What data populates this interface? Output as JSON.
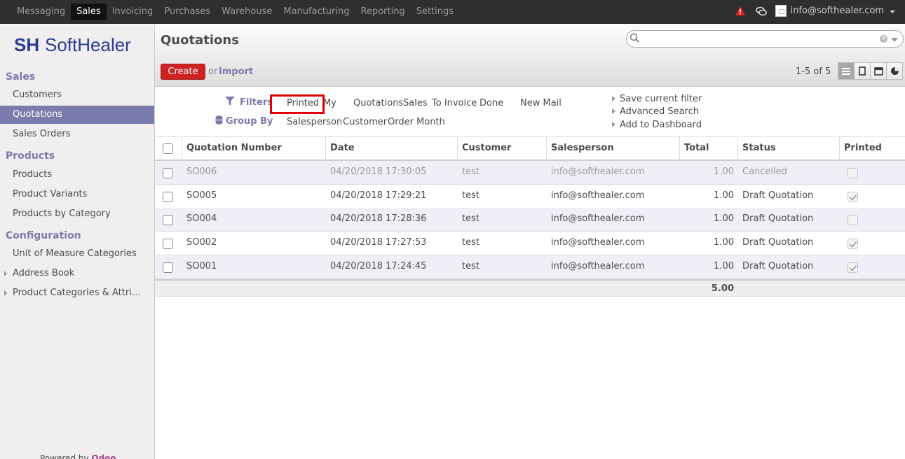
{
  "topbar": {
    "menu": [
      "Messaging",
      "Sales",
      "Invoicing",
      "Purchases",
      "Warehouse",
      "Manufacturing",
      "Reporting",
      "Settings"
    ],
    "active_menu": "Sales",
    "user_email": "info@softhealer.com",
    "icons": [
      "warning-icon",
      "chat-icon",
      "avatar",
      "chevron-down-icon"
    ]
  },
  "sidebar": {
    "logo_text": "SoftHealer",
    "sections": [
      {
        "title": "Sales",
        "items": [
          "Customers",
          "Quotations",
          "Sales Orders"
        ]
      },
      {
        "title": "Products",
        "items": [
          "Products",
          "Product Variants",
          "Products by Category"
        ]
      },
      {
        "title": "Configuration",
        "items": [
          "Unit of Measure Categories",
          "Address Book",
          "Product Categories & Attri…"
        ]
      }
    ],
    "active_item": "Quotations",
    "powered_prefix": "Powered by",
    "powered_brand": "Odoo"
  },
  "control_panel": {
    "title": "Quotations",
    "search_placeholder": "",
    "create_label": "Create",
    "or_label": "or",
    "import_label": "Import",
    "pager": "1-5 of 5",
    "views": [
      "list-view-icon",
      "kanban-view-icon",
      "calendar-view-icon",
      "graph-view-icon"
    ],
    "active_view": "list-view-icon"
  },
  "filters": {
    "filters_label": "Filters",
    "group_by_label": "Group By",
    "filter_items": [
      "Printed",
      "My",
      "Quotations",
      "Sales",
      "To Invoice",
      "Done",
      "New Mail"
    ],
    "highlighted_filter": "Printed",
    "group_items": [
      "Salesperson",
      "Customer",
      "Order Month"
    ],
    "options": [
      "Save current filter",
      "Advanced Search",
      "Add to Dashboard"
    ]
  },
  "table": {
    "columns": [
      "Quotation Number",
      "Date",
      "Customer",
      "Salesperson",
      "Total",
      "Status",
      "Printed"
    ],
    "rows": [
      {
        "number": "SO006",
        "date": "04/20/2018 17:30:05",
        "customer": "test",
        "salesperson": "info@softhealer.com",
        "total": "1.00",
        "status": "Cancelled",
        "printed": false
      },
      {
        "number": "SO005",
        "date": "04/20/2018 17:29:21",
        "customer": "test",
        "salesperson": "info@softhealer.com",
        "total": "1.00",
        "status": "Draft Quotation",
        "printed": true
      },
      {
        "number": "SO004",
        "date": "04/20/2018 17:28:36",
        "customer": "test",
        "salesperson": "info@softhealer.com",
        "total": "1.00",
        "status": "Draft Quotation",
        "printed": false
      },
      {
        "number": "SO002",
        "date": "04/20/2018 17:27:53",
        "customer": "test",
        "salesperson": "info@softhealer.com",
        "total": "1.00",
        "status": "Draft Quotation",
        "printed": true
      },
      {
        "number": "SO001",
        "date": "04/20/2018 17:24:45",
        "customer": "test",
        "salesperson": "info@softhealer.com",
        "total": "1.00",
        "status": "Draft Quotation",
        "printed": true
      }
    ],
    "sum_total": "5.00"
  },
  "colors": {
    "accent": "#7c7bad",
    "create": "#cc2222",
    "highlight": "#e00000",
    "topbar": "#2f2f2f"
  }
}
